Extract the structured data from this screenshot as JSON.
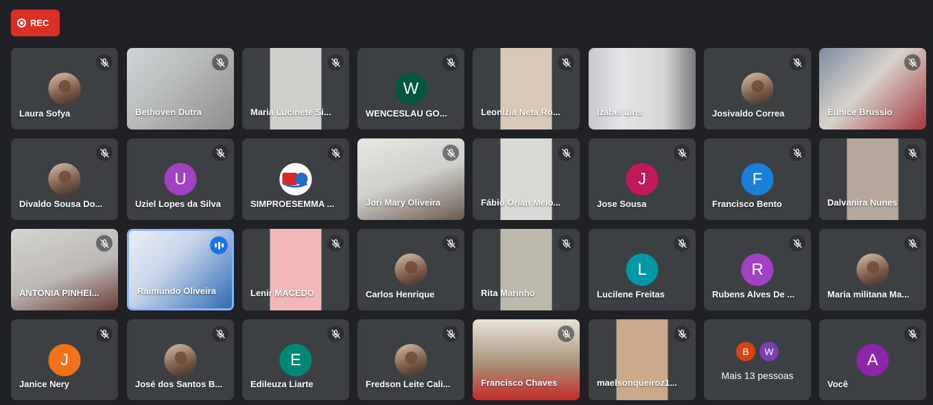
{
  "recording": {
    "label": "REC"
  },
  "colors": {
    "background": "#202124",
    "tile": "#3c4043",
    "rec": "#d93025",
    "speaking_border": "#8ab4f8"
  },
  "participants": [
    {
      "name": "Laura Sofya",
      "kind": "photo",
      "bg": "#3c4043",
      "muted": true
    },
    {
      "name": "Bethoven Dutra",
      "kind": "video",
      "bg": "linear-gradient(135deg,#cfd4d6 0%,#b9bdbc 40%,#8c8f8c 100%)",
      "muted": true
    },
    {
      "name": "Maria Lucinete Si...",
      "kind": "video",
      "bg": "linear-gradient(90deg,#3c4043 0 26%,#cdd0c9 26% 74%,#3c4043 74%)",
      "muted": true
    },
    {
      "name": "WENCESLAU GO...",
      "kind": "letter",
      "letter": "W",
      "color": "#00573d",
      "bg": "#3c4043",
      "muted": true
    },
    {
      "name": "Leonizia Neta Ro...",
      "kind": "video",
      "bg": "linear-gradient(90deg,#3c4043 0 26%,#d9c8b5 26% 74%,#3c4043 74%)",
      "muted": true
    },
    {
      "name": "Izabel Lins",
      "kind": "video",
      "bg": "linear-gradient(90deg,#c6c9cc 0%,#e3e5e6 30%,#d5d7d8 70%,#7a7c7d 100%)",
      "muted": false
    },
    {
      "name": "Josivaldo Correa",
      "kind": "photo",
      "bg": "#3c4043",
      "muted": true
    },
    {
      "name": "Eunice Brussio",
      "kind": "video",
      "bg": "linear-gradient(135deg,#7a8ca0 0%,#d8d3cb 45%,#a4363c 100%)",
      "muted": true
    },
    {
      "name": "Divaldo Sousa Do...",
      "kind": "photo",
      "bg": "#3c4043",
      "muted": true
    },
    {
      "name": "Uziel Lopes da Silva",
      "kind": "letter",
      "letter": "U",
      "color": "#a142c5",
      "bg": "#3c4043",
      "muted": true
    },
    {
      "name": "SIMPROESEMMA ...",
      "kind": "logo",
      "bg": "#3c4043",
      "muted": true
    },
    {
      "name": "Jori Mary Oliveira",
      "kind": "video",
      "bg": "linear-gradient(160deg,#e6e6e3 0%,#cfcfcb 50%,#6b5a4f 100%)",
      "muted": true
    },
    {
      "name": "Fábio Orlan Melo...",
      "kind": "video",
      "bg": "linear-gradient(90deg,#3c4043 0 26%,#d9d9d6 26% 74%,#3c4043 74%)",
      "muted": true
    },
    {
      "name": "Jose Sousa",
      "kind": "letter",
      "letter": "J",
      "color": "#c4185c",
      "bg": "#3c4043",
      "muted": true
    },
    {
      "name": "Francisco Bento",
      "kind": "letter",
      "letter": "F",
      "color": "#1a7fd8",
      "bg": "#3c4043",
      "muted": true
    },
    {
      "name": "Dalvanira Nunes",
      "kind": "video",
      "bg": "linear-gradient(90deg,#3c4043 0 26%,#b6a79c 26% 74%,#3c4043 74%)",
      "muted": true
    },
    {
      "name": "ANTONIA PINHEI...",
      "kind": "video",
      "bg": "linear-gradient(160deg,#d4d3d0 0%,#bcb9b5 55%,#6a3a33 100%)",
      "muted": true
    },
    {
      "name": "Raimundo Oliveira",
      "kind": "video",
      "bg": "linear-gradient(135deg,#e9eef5 0%,#c9d6ea 40%,#2f6bb5 100%)",
      "muted": false,
      "speaking": true
    },
    {
      "name": "Lenir MACEDO",
      "kind": "video",
      "bg": "linear-gradient(90deg,#3c4043 0 26%,#f2b7b9 26% 74%,#3c4043 74%)",
      "muted": true
    },
    {
      "name": "Carlos Henrique",
      "kind": "photo",
      "bg": "#3c4043",
      "muted": true
    },
    {
      "name": "Rita Marinho",
      "kind": "video",
      "bg": "linear-gradient(90deg,#3c4043 0 26%,#bdb8ac 26% 74%,#3c4043 74%)",
      "muted": true
    },
    {
      "name": "Lucilene Freitas",
      "kind": "letter",
      "letter": "L",
      "color": "#0097a7",
      "bg": "#3c4043",
      "muted": true
    },
    {
      "name": "Rubens Alves De ...",
      "kind": "letter",
      "letter": "R",
      "color": "#a142c5",
      "bg": "#3c4043",
      "muted": true
    },
    {
      "name": "Maria militana Ma...",
      "kind": "photo",
      "bg": "#3c4043",
      "muted": true
    },
    {
      "name": "Janice Nery",
      "kind": "letter",
      "letter": "J",
      "color": "#f2711c",
      "bg": "#3c4043",
      "muted": true
    },
    {
      "name": "José dos Santos B...",
      "kind": "photo",
      "bg": "#3c4043",
      "muted": true
    },
    {
      "name": "Edileuza Liarte",
      "kind": "letter",
      "letter": "E",
      "color": "#00897b",
      "bg": "#3c4043",
      "muted": true
    },
    {
      "name": "Fredson Leite Cali...",
      "kind": "photo",
      "bg": "#3c4043",
      "muted": true
    },
    {
      "name": "Francisco Chaves",
      "kind": "video",
      "bg": "linear-gradient(180deg,#e8e3d8 0%,#a8927a 55%,#c62b27 100%)",
      "muted": true
    },
    {
      "name": "maelsonqueiroz1...",
      "kind": "video",
      "bg": "linear-gradient(90deg,#3c4043 0 26%,#c9a98a 26% 74%,#3c4043 74%)",
      "muted": true
    },
    {
      "name": "",
      "kind": "more",
      "more_label": "Mais 13 pessoas",
      "minis": [
        {
          "letter": "B",
          "color": "#d84315"
        },
        {
          "letter": "W",
          "color": "#7b3fb3"
        }
      ],
      "bg": "#3c4043",
      "muted": false
    },
    {
      "name": "Você",
      "kind": "letter",
      "letter": "A",
      "color": "#8e24aa",
      "bg": "#3c4043",
      "muted": true
    }
  ]
}
